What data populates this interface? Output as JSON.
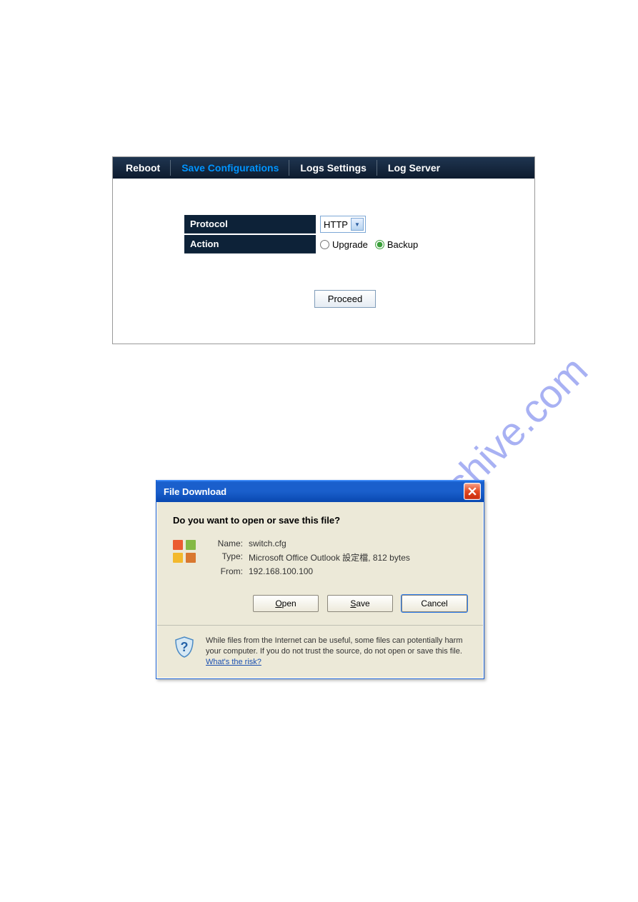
{
  "watermark": "manualshive.com",
  "config_panel": {
    "tabs": {
      "reboot": "Reboot",
      "save_configurations": "Save Configurations",
      "logs_settings": "Logs Settings",
      "log_server": "Log Server"
    },
    "form": {
      "protocol_label": "Protocol",
      "protocol_value": "HTTP",
      "action_label": "Action",
      "upgrade_label": "Upgrade",
      "backup_label": "Backup",
      "selected_action": "Backup"
    },
    "proceed_button": "Proceed"
  },
  "dialog": {
    "title": "File Download",
    "question": "Do you want to open or save this file?",
    "info": {
      "name_label": "Name:",
      "name_value": "switch.cfg",
      "type_label": "Type:",
      "type_value": "Microsoft Office Outlook 設定檔, 812 bytes",
      "from_label": "From:",
      "from_value": "192.168.100.100"
    },
    "buttons": {
      "open_before": "",
      "open_u": "O",
      "open_after": "pen",
      "save_before": "",
      "save_u": "S",
      "save_after": "ave",
      "cancel": "Cancel"
    },
    "warning_text": "While files from the Internet can be useful, some files can potentially harm your computer. If you do not trust the source, do not open or save this file. ",
    "risk_link": "What's the risk?"
  }
}
